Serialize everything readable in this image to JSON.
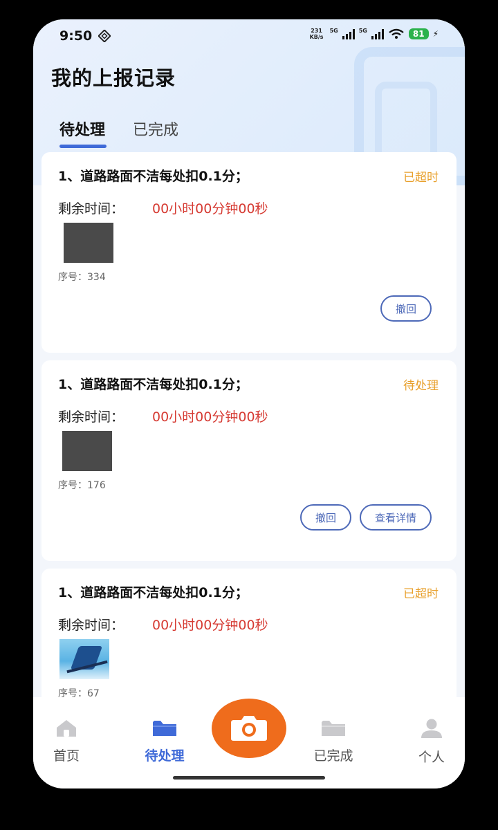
{
  "status_bar": {
    "time": "9:50",
    "net_speed": "231 KB/s",
    "signal_1": "5G",
    "signal_2": "5G",
    "battery": "81"
  },
  "header": {
    "title": "我的上报记录"
  },
  "tabs": [
    {
      "label": "待处理",
      "active": true
    },
    {
      "label": "已完成",
      "active": false
    }
  ],
  "records": [
    {
      "title": "1、道路路面不洁每处扣0.1分；",
      "status": "已超时",
      "remain_label": "剩余时间：",
      "remain_value": "00小时00分钟00秒",
      "serial": "序号：334",
      "actions": [
        "撤回"
      ]
    },
    {
      "title": "1、道路路面不洁每处扣0.1分；",
      "status": "待处理",
      "remain_label": "剩余时间：",
      "remain_value": "00小时00分钟00秒",
      "serial": "序号：176",
      "actions": [
        "撤回",
        "查看详情"
      ]
    },
    {
      "title": "1、道路路面不洁每处扣0.1分；",
      "status": "已超时",
      "remain_label": "剩余时间：",
      "remain_value": "00小时00分钟00秒",
      "serial": "序号：67",
      "actions": []
    }
  ],
  "bottom_nav": {
    "items": [
      {
        "label": "首页",
        "icon": "home-icon",
        "active": false
      },
      {
        "label": "待处理",
        "icon": "folder-icon",
        "active": true
      },
      {
        "label": "已完成",
        "icon": "folder-icon",
        "active": false
      },
      {
        "label": "个人",
        "icon": "user-icon",
        "active": false
      }
    ],
    "camera_icon": "camera-icon"
  },
  "colors": {
    "accent": "#3f6ad8",
    "camera": "#ef6c1c",
    "overdue": "#e8a02c",
    "countdown": "#d63b33",
    "button_border": "#4d69b8"
  }
}
